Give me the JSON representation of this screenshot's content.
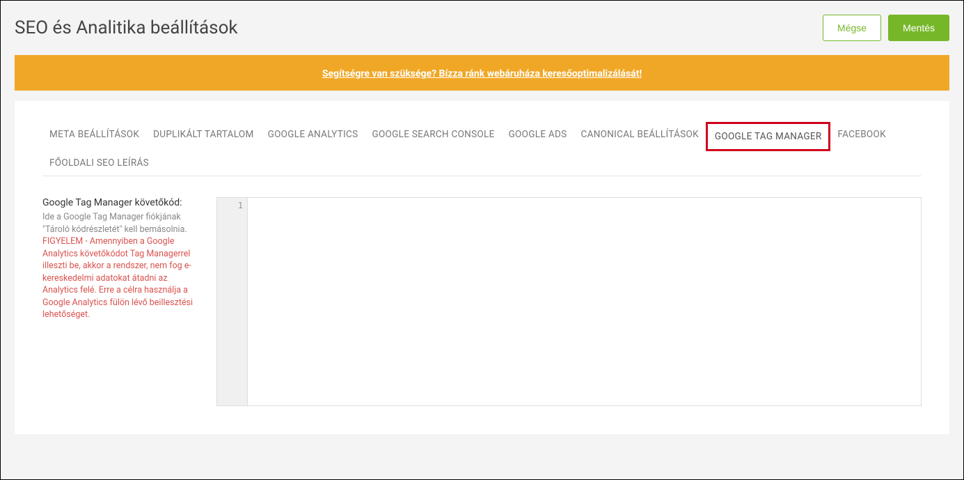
{
  "header": {
    "title": "SEO és Analitika beállítások",
    "cancel_label": "Mégse",
    "save_label": "Mentés"
  },
  "alert": {
    "text": "Segítségre van szüksége? Bízza ránk webáruháza keresőoptimalizálását!"
  },
  "tabs": [
    {
      "label": "META BEÁLLÍTÁSOK",
      "active": false
    },
    {
      "label": "DUPLIKÁLT TARTALOM",
      "active": false
    },
    {
      "label": "GOOGLE ANALYTICS",
      "active": false
    },
    {
      "label": "GOOGLE SEARCH CONSOLE",
      "active": false
    },
    {
      "label": "GOOGLE ADS",
      "active": false
    },
    {
      "label": "CANONICAL BEÁLLÍTÁSOK",
      "active": false
    },
    {
      "label": "GOOGLE TAG MANAGER",
      "active": true
    },
    {
      "label": "FACEBOOK",
      "active": false
    },
    {
      "label": "FŐOLDALI SEO LEÍRÁS",
      "active": false
    }
  ],
  "form": {
    "gtm_label": "Google Tag Manager követőkód:",
    "gtm_desc": "Ide a Google Tag Manager fiókjának \"Tároló kódrészletét\" kell bemásolnia.",
    "gtm_warn": "FIGYELEM - Amennyiben a Google Analytics követőkódot Tag Managerrel illeszti be, akkor a rendszer, nem fog e-kereskedelmi adatokat átadni az Analytics felé. Erre a célra használja a Google Analytics fülön lévő beillesztési lehetőséget.",
    "editor_line1": "1",
    "editor_value": ""
  }
}
